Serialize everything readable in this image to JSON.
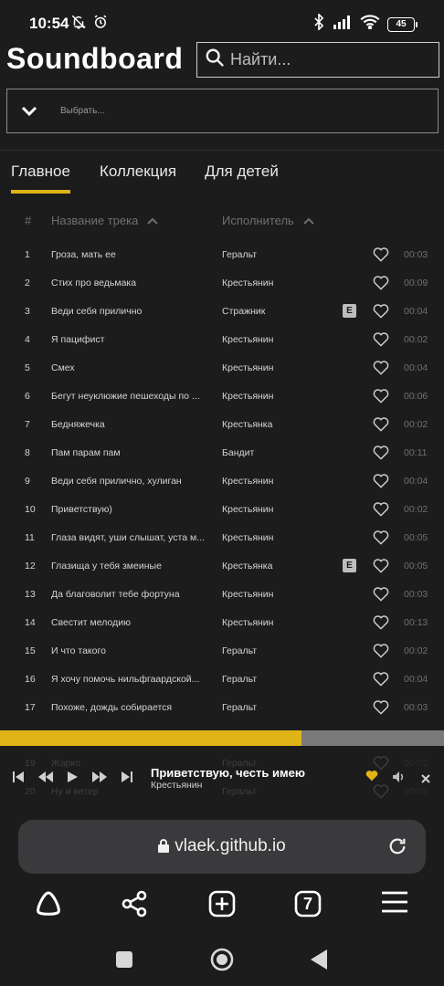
{
  "status": {
    "time": "10:54",
    "battery": "45"
  },
  "header": {
    "title": "Soundboard",
    "search_placeholder": "Найти...",
    "select_placeholder": "Выбрать..."
  },
  "tabs": [
    {
      "label": "Главное",
      "active": true
    },
    {
      "label": "Коллекция",
      "active": false
    },
    {
      "label": "Для детей",
      "active": false
    }
  ],
  "table": {
    "col_num": "#",
    "col_title": "Название трека",
    "col_artist": "Исполнитель",
    "rows": [
      {
        "num": "1",
        "title": "Гроза, мать ее",
        "artist": "Геральт",
        "explicit": false,
        "duration": "00:03"
      },
      {
        "num": "2",
        "title": "Стих про ведьмака",
        "artist": "Крестьянин",
        "explicit": false,
        "duration": "00:09"
      },
      {
        "num": "3",
        "title": "Веди себя прилично",
        "artist": "Стражник",
        "explicit": true,
        "duration": "00:04"
      },
      {
        "num": "4",
        "title": "Я пацифист",
        "artist": "Крестьянин",
        "explicit": false,
        "duration": "00:02"
      },
      {
        "num": "5",
        "title": "Смех",
        "artist": "Крестьянин",
        "explicit": false,
        "duration": "00:04"
      },
      {
        "num": "6",
        "title": "Бегут неуклюжие пешеходы по ...",
        "artist": "Крестьянин",
        "explicit": false,
        "duration": "00:06"
      },
      {
        "num": "7",
        "title": "Бедняжечка",
        "artist": "Крестьянка",
        "explicit": false,
        "duration": "00:02"
      },
      {
        "num": "8",
        "title": "Пам парам пам",
        "artist": "Бандит",
        "explicit": false,
        "duration": "00:11"
      },
      {
        "num": "9",
        "title": "Веди себя прилично, хулиган",
        "artist": "Крестьянин",
        "explicit": false,
        "duration": "00:04"
      },
      {
        "num": "10",
        "title": "Приветствую)",
        "artist": "Крестьянин",
        "explicit": false,
        "duration": "00:02"
      },
      {
        "num": "11",
        "title": "Глаза видят, уши слышат, уста м...",
        "artist": "Крестьянин",
        "explicit": false,
        "duration": "00:05"
      },
      {
        "num": "12",
        "title": "Глазища у тебя змеиные",
        "artist": "Крестьянка",
        "explicit": true,
        "duration": "00:05"
      },
      {
        "num": "13",
        "title": "Да благоволит тебе фортуна",
        "artist": "Крестьянин",
        "explicit": false,
        "duration": "00:03"
      },
      {
        "num": "14",
        "title": "Свестит мелодию",
        "artist": "Крестьянин",
        "explicit": false,
        "duration": "00:13"
      },
      {
        "num": "15",
        "title": "И что такого",
        "artist": "Геральт",
        "explicit": false,
        "duration": "00:02"
      },
      {
        "num": "16",
        "title": "Я хочу помочь нильфгаардской...",
        "artist": "Геральт",
        "explicit": false,
        "duration": "00:04"
      },
      {
        "num": "17",
        "title": "Похоже, дождь собирается",
        "artist": "Геральт",
        "explicit": false,
        "duration": "00:03"
      }
    ],
    "hidden_rows": [
      {
        "num": "19",
        "title": "Жарко",
        "artist": "Геральт",
        "duration": "00:02"
      },
      {
        "num": "20",
        "title": "Ну и ветер",
        "artist": "Геральт",
        "duration": "00:02"
      }
    ]
  },
  "player": {
    "title": "Приветствую, честь имею",
    "artist": "Крестьянин",
    "progress": 0.68,
    "liked": true
  },
  "browser": {
    "url": "vlaek.github.io",
    "tab_count": "7"
  },
  "colors": {
    "accent": "#e0b417",
    "background": "#1c1c1c",
    "muted": "#6f6f6f"
  }
}
